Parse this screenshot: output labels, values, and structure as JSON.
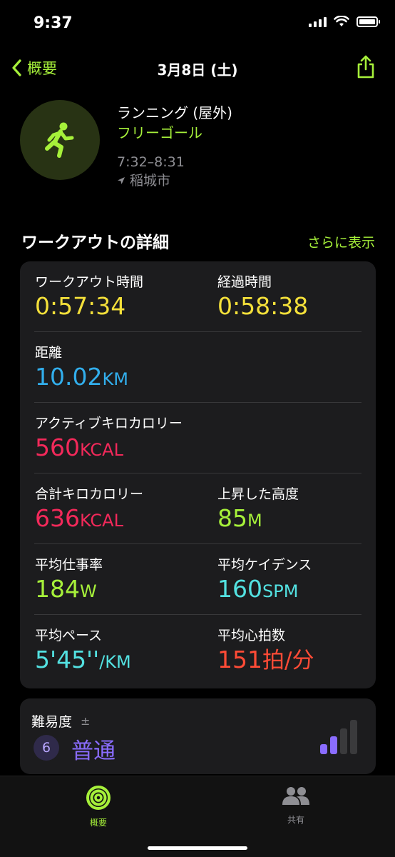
{
  "status_bar": {
    "time": "9:37"
  },
  "nav": {
    "back_label": "概要",
    "title": "3月8日 (土)",
    "share_icon": "share-icon"
  },
  "workout": {
    "type": "ランニング (屋外)",
    "goal": "フリーゴール",
    "time_range": "7:32–8:31",
    "location": "稲城市",
    "icon": "running-figure-icon"
  },
  "details": {
    "section_title": "ワークアウトの詳細",
    "show_more": "さらに表示",
    "workout_time": {
      "label": "ワークアウト時間",
      "value": "0:57:34"
    },
    "elapsed_time": {
      "label": "経過時間",
      "value": "0:58:38"
    },
    "distance": {
      "label": "距離",
      "value": "10.02",
      "unit": "KM"
    },
    "active_kcal": {
      "label": "アクティブキロカロリー",
      "value": "560",
      "unit": "KCAL"
    },
    "total_kcal": {
      "label": "合計キロカロリー",
      "value": "636",
      "unit": "KCAL"
    },
    "elevation_gain": {
      "label": "上昇した高度",
      "value": "85",
      "unit": "M"
    },
    "avg_power": {
      "label": "平均仕事率",
      "value": "184",
      "unit": "W"
    },
    "avg_cadence": {
      "label": "平均ケイデンス",
      "value": "160",
      "unit": "SPM"
    },
    "avg_pace": {
      "label": "平均ペース",
      "value": "5'45''",
      "unit": "/KM"
    },
    "avg_heart_rate": {
      "label": "平均心拍数",
      "value": "151",
      "unit": "拍/分"
    }
  },
  "effort": {
    "title": "難易度",
    "pm_symbol": "±",
    "score": "6",
    "level": "普通",
    "bars_filled": 2,
    "bars_total": 4
  },
  "tabbar": {
    "summary_label": "概要",
    "sharing_label": "共有"
  },
  "colors": {
    "accent": "#a6f03a",
    "time": "#f4e03a",
    "distance": "#32aeec",
    "calories": "#f2295a",
    "cadence": "#53e1e1",
    "heart_rate": "#ff4b36",
    "effort": "#8a6cff"
  }
}
